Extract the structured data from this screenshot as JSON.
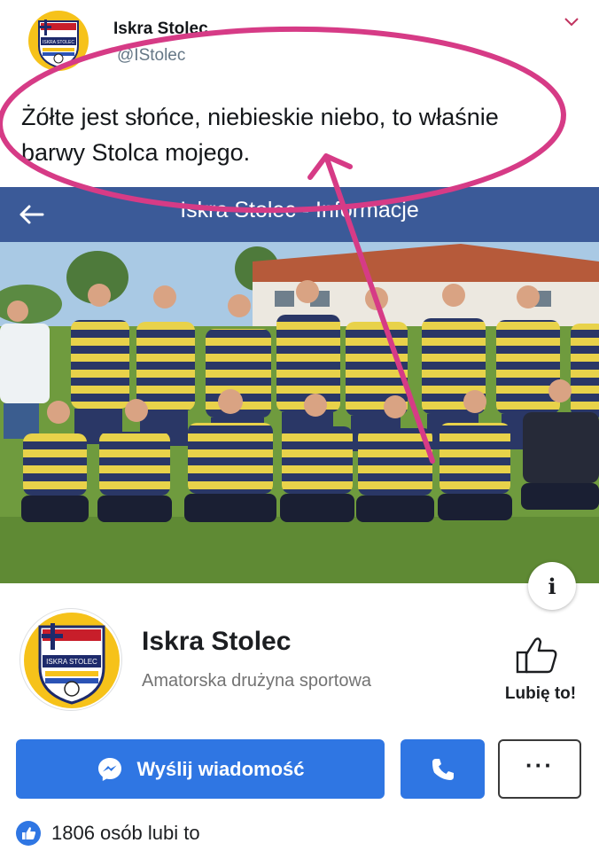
{
  "tweet": {
    "display_name": "Iskra Stolec",
    "handle": "@IStolec",
    "text_line1": "Żółte jest słońce, niebieskie niebo, to właśnie",
    "text_line2": "barwy Stolca mojego.",
    "chevron_icon": "chevron-down-icon"
  },
  "facebook": {
    "header_title": "Iskra Stolec - Informacje",
    "back_icon": "back-arrow-icon",
    "info_label": "i",
    "page_name": "Iskra Stolec",
    "page_category": "Amatorska drużyna sportowa",
    "like_label": "Lubię to!",
    "message_button_label": "Wyślij wiadomość",
    "more_button_label": "···",
    "likes_count_text": "1806 osób lubi to",
    "crest_text": "ISKRA STOLEC"
  },
  "colors": {
    "facebook_blue": "#3b5a98",
    "button_blue": "#2f76e3",
    "annotation_pink": "#d63b86",
    "jersey_yellow": "#e8d24a",
    "jersey_navy": "#2a3766"
  }
}
